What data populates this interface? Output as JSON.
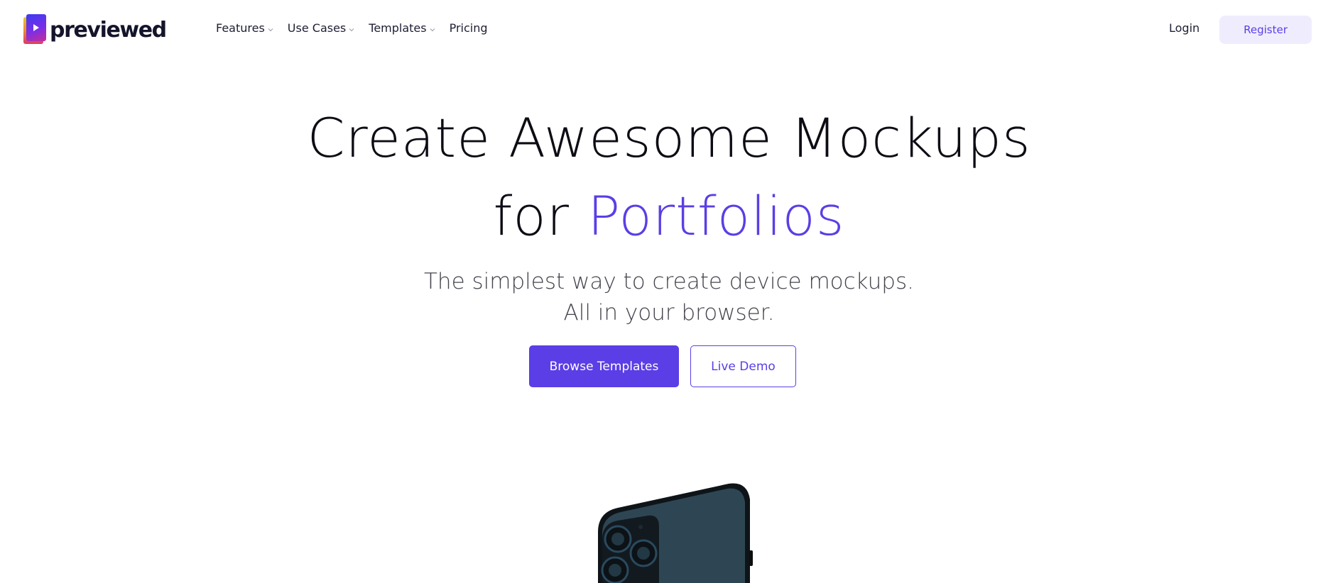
{
  "brand": {
    "name": "previewed"
  },
  "nav": {
    "items": [
      {
        "label": "Features",
        "has_dropdown": true
      },
      {
        "label": "Use Cases",
        "has_dropdown": true
      },
      {
        "label": "Templates",
        "has_dropdown": true
      },
      {
        "label": "Pricing",
        "has_dropdown": false
      }
    ]
  },
  "auth": {
    "login_label": "Login",
    "register_label": "Register"
  },
  "hero": {
    "title_line1": "Create Awesome Mockups",
    "title_line2_prefix": "for",
    "title_line2_accent": "Portfolios",
    "subtitle_line1": "The simplest way to create device mockups.",
    "subtitle_line2": "All in your browser.",
    "primary_cta": "Browse Templates",
    "secondary_cta": "Live Demo"
  },
  "colors": {
    "accent": "#5b3ee6",
    "register_bg": "#efedfd",
    "text_dark": "#0c0c14"
  },
  "icons": {
    "logo": "play-icon",
    "dropdown": "chevron-down-icon"
  }
}
